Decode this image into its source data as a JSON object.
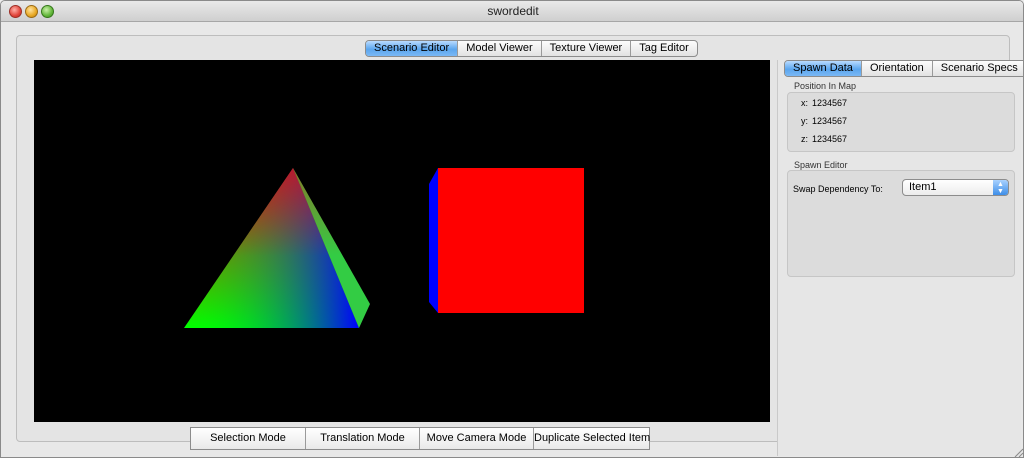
{
  "window": {
    "title": "swordedit"
  },
  "main_tabs": [
    {
      "label": "Scenario Editor",
      "active": true
    },
    {
      "label": "Model Viewer",
      "active": false
    },
    {
      "label": "Texture Viewer",
      "active": false
    },
    {
      "label": "Tag Editor",
      "active": false
    }
  ],
  "mode_buttons": [
    {
      "label": "Selection Mode"
    },
    {
      "label": "Translation Mode"
    },
    {
      "label": "Move Camera Mode"
    },
    {
      "label": "Duplicate Selected Item"
    }
  ],
  "side_tabs": [
    {
      "label": "Spawn Data",
      "active": true
    },
    {
      "label": "Orientation",
      "active": false
    },
    {
      "label": "Scenario Specs",
      "active": false
    }
  ],
  "position_group": {
    "title": "Position In Map",
    "x_label": "x:",
    "x_value": "1234567",
    "y_label": "y:",
    "y_value": "1234567",
    "z_label": "z:",
    "z_value": "1234567"
  },
  "spawn_group": {
    "title": "Spawn Editor",
    "swap_label": "Swap Dependency To:",
    "swap_value": "Item1"
  },
  "colors": {
    "viewport_bg": "#000000",
    "cube_front": "#ff0000",
    "cube_side": "#0000ff",
    "tab_active": "#5ba6ee"
  }
}
